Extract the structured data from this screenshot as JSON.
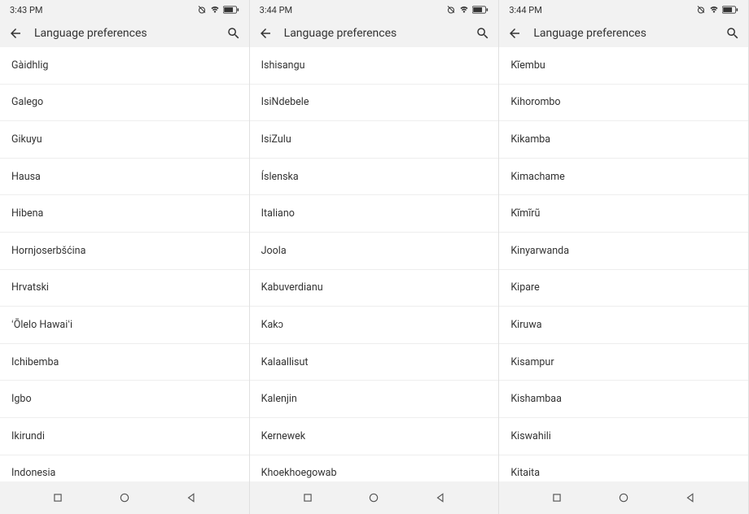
{
  "screens": [
    {
      "time": "3:43 PM",
      "title": "Language preferences",
      "items": [
        "Gàidhlig",
        "Galego",
        "Gikuyu",
        "Hausa",
        "Hibena",
        "Hornjoserbšćina",
        "Hrvatski",
        "ʻŌlelo Hawaiʻi",
        "Ichibemba",
        "Igbo",
        "Ikirundi",
        "Indonesia"
      ]
    },
    {
      "time": "3:44 PM",
      "title": "Language preferences",
      "items": [
        "Ishisangu",
        "IsiNdebele",
        "IsiZulu",
        "Íslenska",
        "Italiano",
        "Joola",
        "Kabuverdianu",
        "Kakɔ",
        "Kalaallisut",
        "Kalenjin",
        "Kernewek",
        "Khoekhoegowab"
      ]
    },
    {
      "time": "3:44 PM",
      "title": "Language preferences",
      "items": [
        "Kĩembu",
        "Kihorombo",
        "Kikamba",
        "Kimachame",
        "Kĩmĩrũ",
        "Kinyarwanda",
        "Kipare",
        "Kiruwa",
        "Kisampur",
        "Kishambaa",
        "Kiswahili",
        "Kitaita"
      ]
    }
  ]
}
